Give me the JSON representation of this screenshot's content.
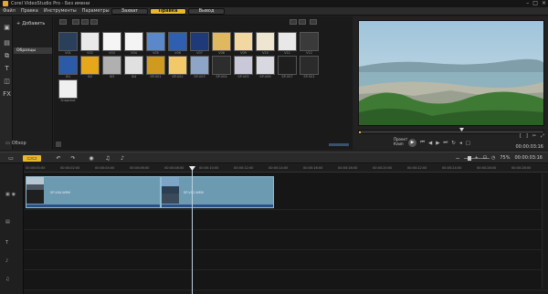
{
  "app": {
    "title": "Corel VideoStudio Pro - Без имени"
  },
  "menu": [
    "Файл",
    "Правка",
    "Инструменты",
    "Параметры"
  ],
  "steps": [
    {
      "label": "Захват",
      "active": false
    },
    {
      "label": "Правка",
      "active": true
    },
    {
      "label": "Вывод",
      "active": false
    }
  ],
  "library": {
    "add_label": "Добавить",
    "folders": [
      "Образцы"
    ],
    "browse_label": "Обзор",
    "thumbnails": [
      {
        "caption": "V01",
        "color": "#2a3f5a"
      },
      {
        "caption": "V02",
        "color": "#e9e9e9"
      },
      {
        "caption": "V03",
        "color": "#f5f5f5"
      },
      {
        "caption": "V04",
        "color": "#f4f4f4"
      },
      {
        "caption": "V05",
        "color": "#5a88c8"
      },
      {
        "caption": "V06",
        "color": "#2f5fb0"
      },
      {
        "caption": "V07",
        "color": "#1f3a78"
      },
      {
        "caption": "V08",
        "color": "#e0b860"
      },
      {
        "caption": "V09",
        "color": "#f0d8a0"
      },
      {
        "caption": "V10",
        "color": "#efe6d2"
      },
      {
        "caption": "V11",
        "color": "#e8e8e8"
      },
      {
        "caption": "V12",
        "color": "#3a3a3a"
      },
      {
        "caption": "I01",
        "color": "#2a5aa8"
      },
      {
        "caption": "I02",
        "color": "#e6a818"
      },
      {
        "caption": "I03",
        "color": "#b0b0b0"
      },
      {
        "caption": "I04",
        "color": "#e0e0e0"
      },
      {
        "caption": "SP-V01",
        "color": "#d09a20"
      },
      {
        "caption": "SP-V02",
        "color": "#f1c96a"
      },
      {
        "caption": "SP-V03",
        "color": "#8fa5c8"
      },
      {
        "caption": "SP-V04",
        "color": "#2d2d2d"
      },
      {
        "caption": "SP-V05",
        "color": "#c8c8d8"
      },
      {
        "caption": "SP-V06",
        "color": "#d8d8e0"
      },
      {
        "caption": "SP-V07",
        "color": "#1e1e1e"
      },
      {
        "caption": "SP-S01",
        "color": "#2b2b2b"
      },
      {
        "caption": "Snapshot",
        "color": "#f0f0f0"
      }
    ]
  },
  "preview": {
    "mode_labels": [
      "Проект",
      "Клип"
    ],
    "timecode": "00:00:03:16"
  },
  "timeline": {
    "zoom_percent": "75%",
    "ruler_ticks": [
      "00:00:00:00",
      "00:00:02:00",
      "00:00:04:00",
      "00:00:06:00",
      "00:00:08:00",
      "00:00:10:00",
      "00:00:12:00",
      "00:00:14:00",
      "00:00:16:00",
      "00:00:18:00",
      "00:00:20:00",
      "00:00:22:00",
      "00:00:24:00",
      "00:00:26:00",
      "00:00:28:00"
    ],
    "clips": [
      {
        "name": "SP-V04.WMV",
        "start_s": 0,
        "end_s": 6.6
      },
      {
        "name": "SP-V02.WMV",
        "start_s": 6.6,
        "end_s": 12.0
      }
    ]
  }
}
